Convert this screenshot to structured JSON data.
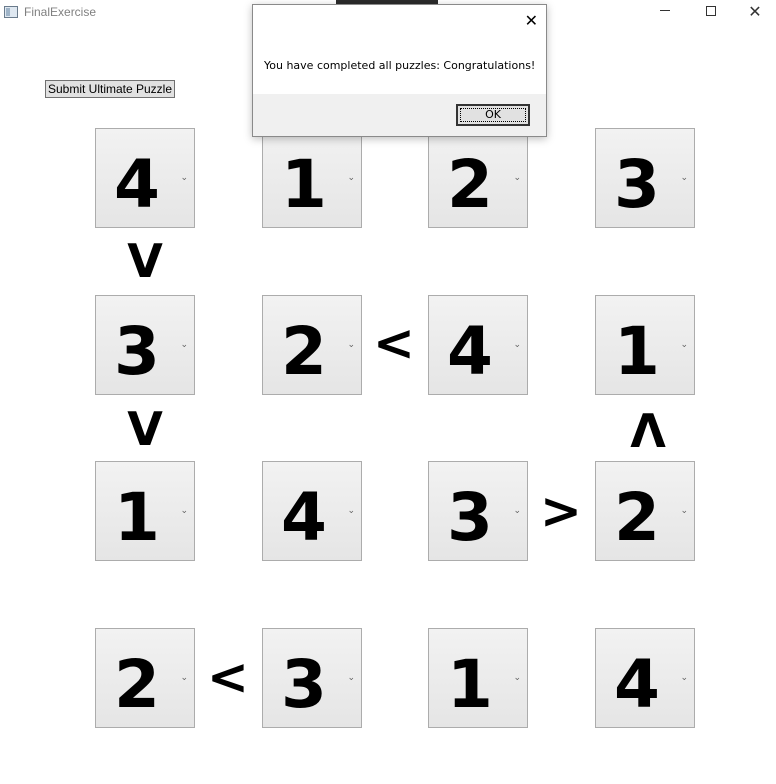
{
  "window": {
    "title": "FinalExercise",
    "close_glyph": "✕"
  },
  "submit_label": "Submit Ultimate Puzzle",
  "grid": {
    "rows": [
      [
        "4",
        "1",
        "2",
        "3"
      ],
      [
        "3",
        "2",
        "4",
        "1"
      ],
      [
        "1",
        "4",
        "3",
        "2"
      ],
      [
        "2",
        "3",
        "1",
        "4"
      ]
    ],
    "dropdown_glyph": "⌄"
  },
  "signs": {
    "r1c1_r2c1": "V",
    "r2c2_r2c3": "<",
    "r2c1_r3c1": "V",
    "r2c4_r3c4": "Λ",
    "r3c3_r3c4": ">",
    "r4c1_r4c2": "<"
  },
  "dialog": {
    "message": "You have completed all puzzles: Congratulations!",
    "ok_label": "OK",
    "close_glyph": "✕"
  }
}
